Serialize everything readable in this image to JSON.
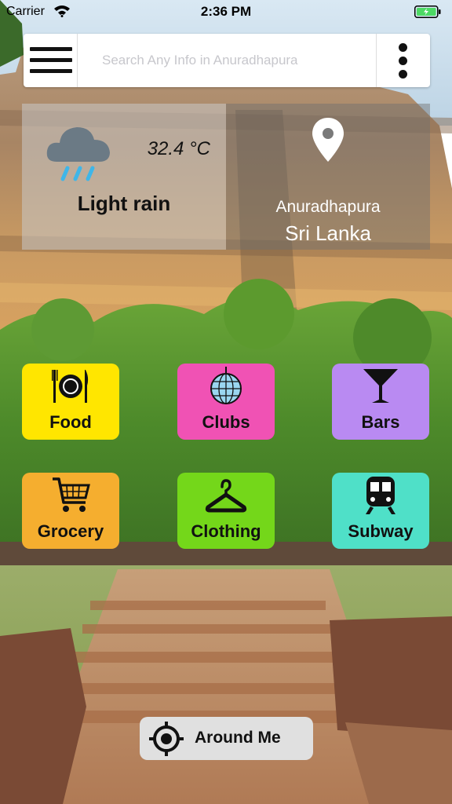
{
  "status_bar": {
    "carrier": "Carrier",
    "time": "2:36 PM"
  },
  "search": {
    "placeholder": "Search Any Info in Anuradhapura",
    "value": ""
  },
  "weather": {
    "temperature": "32.4 °C",
    "condition": "Light rain",
    "icon": "rain-cloud-icon"
  },
  "location": {
    "city": "Anuradhapura",
    "country": "Sri Lanka",
    "icon": "location-pin-icon"
  },
  "categories": [
    {
      "label": "Food",
      "icon": "plate-cutlery-icon",
      "color": "#FFE600"
    },
    {
      "label": "Clubs",
      "icon": "disco-ball-icon",
      "color": "#F052B4"
    },
    {
      "label": "Bars",
      "icon": "cocktail-glass-icon",
      "color": "#B98AF2"
    },
    {
      "label": "Grocery",
      "icon": "shopping-cart-icon",
      "color": "#F5AE2F"
    },
    {
      "label": "Clothing",
      "icon": "hanger-icon",
      "color": "#74D71A"
    },
    {
      "label": "Subway",
      "icon": "train-icon",
      "color": "#4FE0C8"
    }
  ],
  "around_me": {
    "label": "Around Me",
    "icon": "crosshair-icon"
  }
}
